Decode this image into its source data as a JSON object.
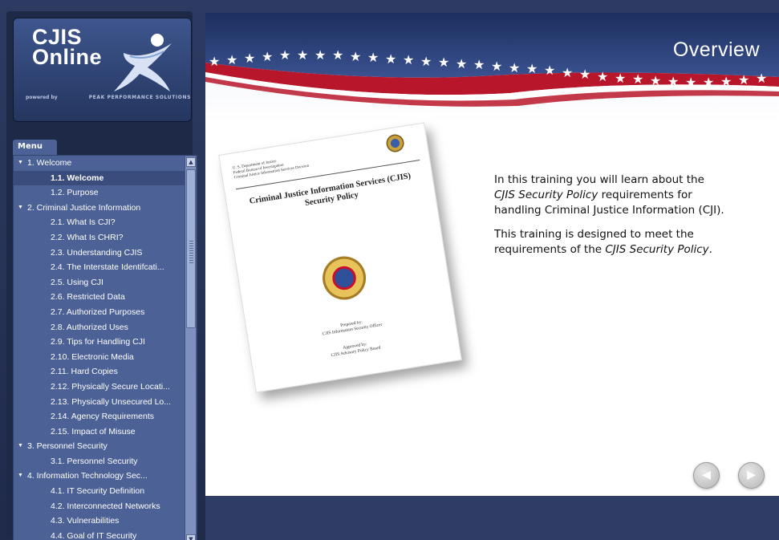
{
  "logo": {
    "title": "CJIS\nOnline",
    "powered_by": "powered by",
    "company": "PEAK PERFORMANCE SOLUTIONS"
  },
  "menu": {
    "tab_label": "Menu",
    "items": [
      {
        "label": "1. Welcome",
        "level": 0,
        "expanded": true
      },
      {
        "label": "1.1. Welcome",
        "level": 1,
        "selected": true
      },
      {
        "label": "1.2. Purpose",
        "level": 1
      },
      {
        "label": "2. Criminal Justice Information",
        "level": 0,
        "expanded": true
      },
      {
        "label": "2.1. What Is CJI?",
        "level": 1
      },
      {
        "label": "2.2. What Is CHRI?",
        "level": 1
      },
      {
        "label": "2.3. Understanding CJIS",
        "level": 1
      },
      {
        "label": "2.4. The Interstate Identifcati...",
        "level": 1
      },
      {
        "label": "2.5. Using CJI",
        "level": 1
      },
      {
        "label": "2.6. Restricted Data",
        "level": 1
      },
      {
        "label": "2.7. Authorized Purposes",
        "level": 1
      },
      {
        "label": "2.8. Authorized Uses",
        "level": 1
      },
      {
        "label": "2.9. Tips for Handling CJI",
        "level": 1
      },
      {
        "label": "2.10. Electronic Media",
        "level": 1
      },
      {
        "label": "2.11. Hard Copies",
        "level": 1
      },
      {
        "label": "2.12. Physically Secure Locati...",
        "level": 1
      },
      {
        "label": "2.13. Physically Unsecured Lo...",
        "level": 1
      },
      {
        "label": "2.14. Agency Requirements",
        "level": 1
      },
      {
        "label": "2.15. Impact of Misuse",
        "level": 1
      },
      {
        "label": "3. Personnel Security",
        "level": 0,
        "expanded": true
      },
      {
        "label": "3.1. Personnel Security",
        "level": 1
      },
      {
        "label": "4. Information Technology Sec...",
        "level": 0,
        "expanded": true
      },
      {
        "label": "4.1. IT Security Definition",
        "level": 1
      },
      {
        "label": "4.2. Interconnected Networks",
        "level": 1
      },
      {
        "label": "4.3. Vulnerabilities",
        "level": 1
      },
      {
        "label": "4.4. Goal of IT Security",
        "level": 1
      }
    ]
  },
  "content": {
    "title": "Overview",
    "document": {
      "header": "U. S. Department of Justice\nFederal Bureau of Investigation\nCriminal Justice Information Services Division",
      "title": "Criminal Justice Information Services (CJIS)\nSecurity Policy",
      "prepared_by": "Prepared by:\nCJIS Information Security Officer",
      "approved_by": "Approved by:\nCJIS Advisory Policy Board"
    },
    "paragraph1_pre": "In this training you will learn about the ",
    "paragraph1_em": "CJIS Security Policy",
    "paragraph1_post": " requirements for handling Criminal Justice Information (CJI).",
    "paragraph2_pre": "This training is designed to meet the requirements of the ",
    "paragraph2_em": "CJIS Security Policy",
    "paragraph2_post": "."
  },
  "nav": {
    "prev_icon": "arrow-left-icon",
    "next_icon": "arrow-right-icon"
  },
  "colors": {
    "frame": "#2d3b63",
    "menu_panel": "#4c6196",
    "banner_blue": "#22366a",
    "banner_red": "#b8162a"
  }
}
